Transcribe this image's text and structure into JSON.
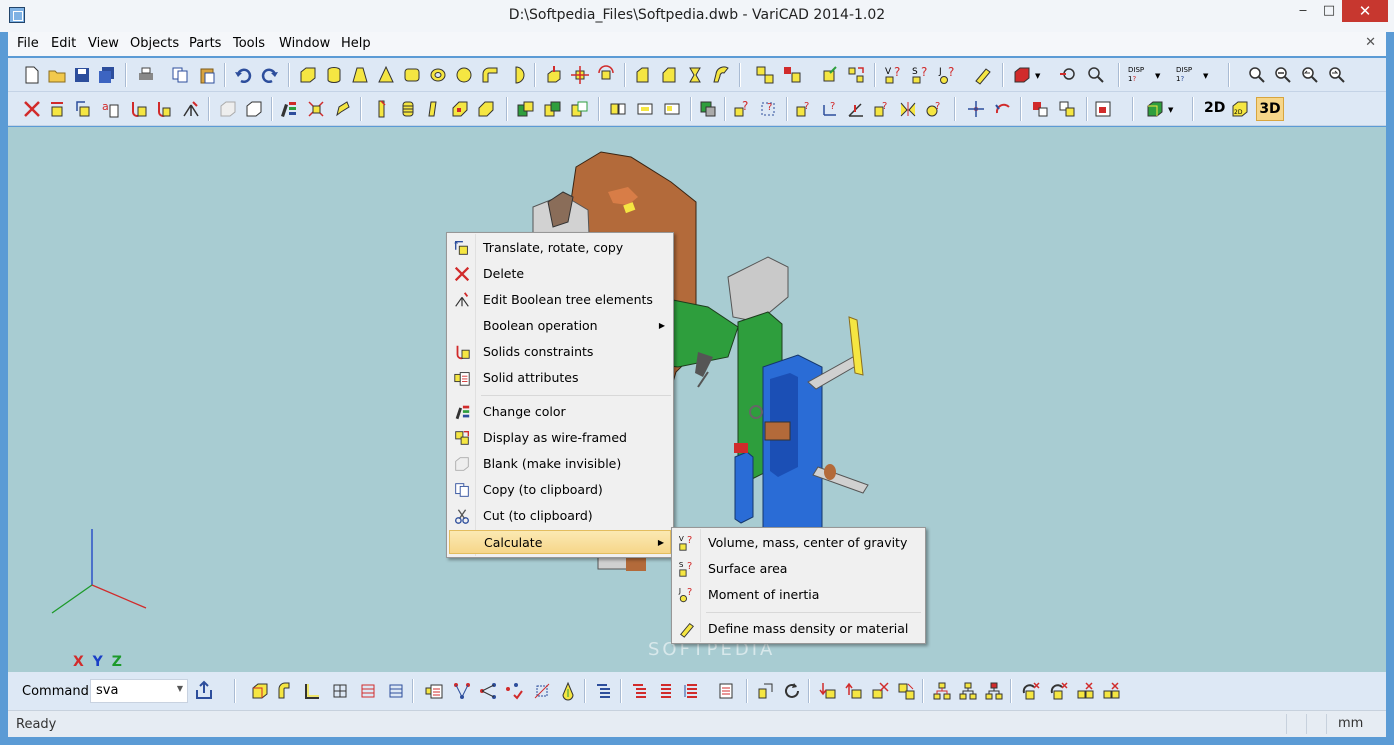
{
  "window": {
    "title": "D:\\Softpedia_Files\\Softpedia.dwb - VariCAD 2014-1.02",
    "minimize": "‒",
    "maximize": "□",
    "close": "✕",
    "mdi_close": "✕"
  },
  "menu": [
    "File",
    "Edit",
    "View",
    "Objects",
    "Parts",
    "Tools",
    "Window",
    "Help"
  ],
  "context_menu": {
    "items": [
      {
        "label": "Translate, rotate, copy",
        "icon": "translate-icon"
      },
      {
        "label": "Delete",
        "icon": "delete-icon"
      },
      {
        "label": "Edit Boolean tree elements",
        "icon": "boolean-tree-icon"
      },
      {
        "label": "Boolean operation",
        "icon": "",
        "submenu": true
      },
      {
        "label": "Solids constraints",
        "icon": "constraints-icon"
      },
      {
        "label": "Solid attributes",
        "icon": "attributes-icon"
      },
      {
        "label": "Change color",
        "icon": "color-icon"
      },
      {
        "label": "Display as wire-framed",
        "icon": "wireframe-icon"
      },
      {
        "label": "Blank (make invisible)",
        "icon": "blank-icon"
      },
      {
        "label": "Copy (to clipboard)",
        "icon": "copy-icon"
      },
      {
        "label": "Cut (to clipboard)",
        "icon": "cut-icon"
      },
      {
        "label": "Calculate",
        "icon": "",
        "submenu": true,
        "highlighted": true
      }
    ]
  },
  "submenu": {
    "items": [
      {
        "label": "Volume, mass, center of gravity",
        "icon": "volume-icon"
      },
      {
        "label": "Surface area",
        "icon": "surface-icon"
      },
      {
        "label": "Moment of inertia",
        "icon": "inertia-icon"
      },
      {
        "label": "Define mass density or material",
        "icon": "density-icon"
      }
    ]
  },
  "toolbar_view": {
    "d2": "2D",
    "d3": "3D",
    "disp": "DISP"
  },
  "command": {
    "label": "Command:",
    "value": "sva"
  },
  "axes": {
    "label": "X Y Z"
  },
  "status": {
    "text": "Ready",
    "units": "mm"
  },
  "watermark": "SOFTPEDIA",
  "colors": {
    "accent": "#f6d68a",
    "viewport": "#a8ccd2",
    "toolbar": "#dde8f5"
  }
}
